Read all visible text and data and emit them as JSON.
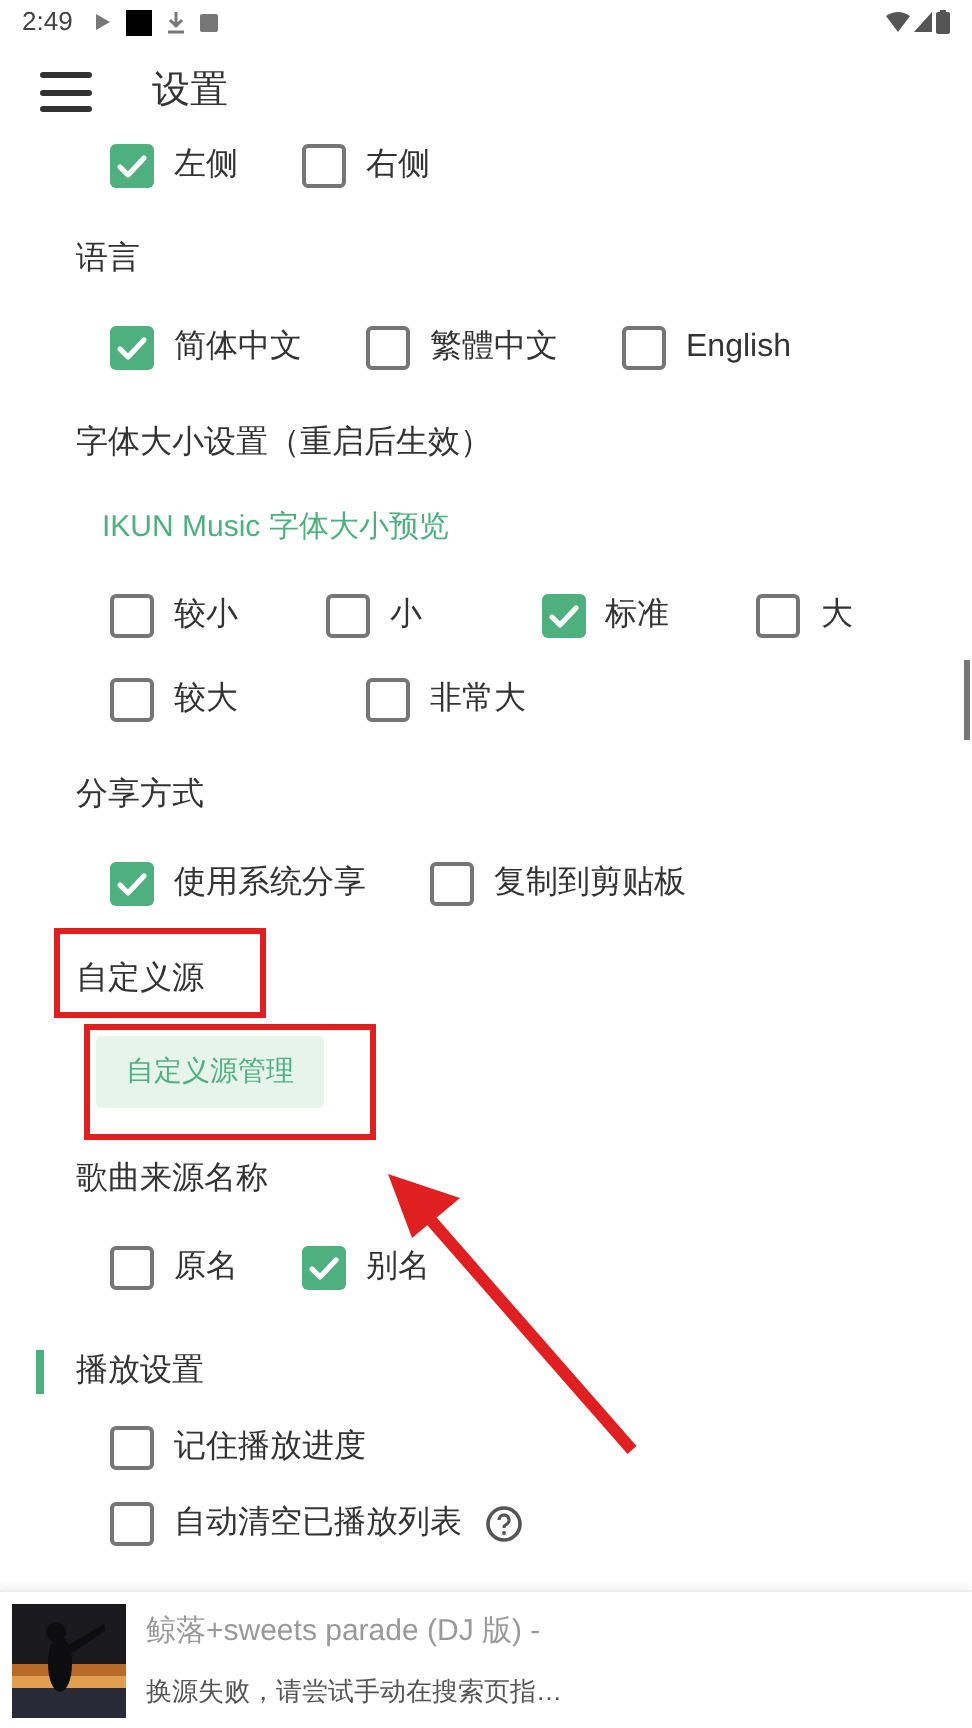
{
  "status_bar": {
    "time": "2:49"
  },
  "header": {
    "title": "设置"
  },
  "clipped_options": [
    {
      "label": "左侧",
      "checked": true
    },
    {
      "label": "右侧",
      "checked": false
    }
  ],
  "sections": [
    {
      "title": "语言",
      "rows": [
        [
          {
            "label": "简体中文",
            "checked": true
          },
          {
            "label": "繁體中文",
            "checked": false
          },
          {
            "label": "English",
            "checked": false
          }
        ]
      ]
    },
    {
      "title": "字体大小设置（重启后生效）",
      "preview": "IKUN Music 字体大小预览",
      "rows": [
        [
          {
            "label": "较小",
            "checked": false
          },
          {
            "label": "小",
            "checked": false
          },
          {
            "label": "标准",
            "checked": true
          },
          {
            "label": "大",
            "checked": false
          }
        ],
        [
          {
            "label": "较大",
            "checked": false
          },
          {
            "label": "非常大",
            "checked": false
          }
        ]
      ]
    },
    {
      "title": "分享方式",
      "rows": [
        [
          {
            "label": "使用系统分享",
            "checked": true
          },
          {
            "label": "复制到剪贴板",
            "checked": false
          }
        ]
      ]
    },
    {
      "title": "自定义源",
      "highlighted": true,
      "button": {
        "label": "自定义源管理",
        "highlighted": true
      }
    },
    {
      "title": "歌曲来源名称",
      "rows": [
        [
          {
            "label": "原名",
            "checked": false
          },
          {
            "label": "别名",
            "checked": true
          }
        ]
      ]
    }
  ],
  "group": {
    "title": "播放设置",
    "options": [
      {
        "label": "记住播放进度",
        "checked": false,
        "help": false
      },
      {
        "label": "自动清空已播放列表",
        "checked": false,
        "help": true
      }
    ]
  },
  "annotation": {
    "kind": "arrow"
  },
  "player": {
    "title": "鲸落+sweets parade (DJ 版) -",
    "subtitle": "换源失败，请尝试手动在搜索页指…"
  }
}
